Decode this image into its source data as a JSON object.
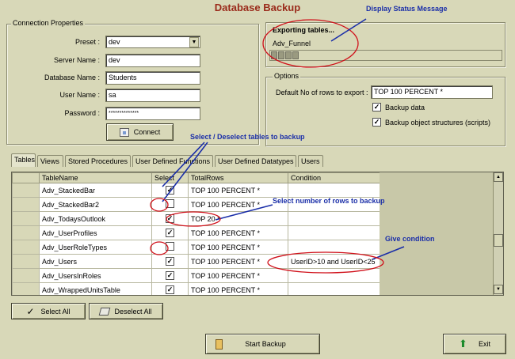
{
  "window": {
    "title": "Database Backup"
  },
  "connection": {
    "group_label": "Connection Properties",
    "preset_label": "Preset :",
    "preset_value": "dev",
    "server_label": "Server Name :",
    "server_value": "dev",
    "database_label": "Database Name :",
    "database_value": "Students",
    "user_label": "User Name :",
    "user_value": "sa",
    "password_label": "Password :",
    "password_value": "**************",
    "connect_label": "Connect"
  },
  "status": {
    "heading": "Exporting tables...",
    "current_table": "Adv_Funnel",
    "progress_fraction": 0.11
  },
  "options": {
    "group_label": "Options",
    "default_rows_label": "Default No of rows to export :",
    "default_rows_value": "TOP 100 PERCENT *",
    "backup_data_label": "Backup data",
    "backup_data_checked": true,
    "backup_structures_label": "Backup object structures (scripts)",
    "backup_structures_checked": true
  },
  "tabs": [
    {
      "label": "Tables",
      "active": true
    },
    {
      "label": "Views"
    },
    {
      "label": "Stored Procedures"
    },
    {
      "label": "User Defined Functions"
    },
    {
      "label": "User Defined Datatypes"
    },
    {
      "label": "Users"
    }
  ],
  "grid": {
    "columns": [
      "TableName",
      "Select",
      "TotalRows",
      "Condition"
    ],
    "rows": [
      {
        "name": "Adv_StackedBar",
        "checked": true,
        "rows": "TOP 100 PERCENT *",
        "condition": ""
      },
      {
        "name": "Adv_StackedBar2",
        "checked": false,
        "rows": "TOP 100 PERCENT *",
        "condition": ""
      },
      {
        "name": "Adv_TodaysOutlook",
        "checked": true,
        "rows": "TOP 20 *",
        "condition": ""
      },
      {
        "name": "Adv_UserProfiles",
        "checked": true,
        "rows": "TOP 100 PERCENT *",
        "condition": ""
      },
      {
        "name": "Adv_UserRoleTypes",
        "checked": false,
        "rows": "TOP 100 PERCENT *",
        "condition": ""
      },
      {
        "name": "Adv_Users",
        "checked": true,
        "rows": "TOP 100 PERCENT *",
        "condition": "UserID>10 and UserID<25"
      },
      {
        "name": "Adv_UsersInRoles",
        "checked": true,
        "rows": "TOP 100 PERCENT *",
        "condition": ""
      },
      {
        "name": "Adv_WrappedUnitsTable",
        "checked": true,
        "rows": "TOP 100 PERCENT *",
        "condition": ""
      }
    ]
  },
  "buttons": {
    "select_all": "Select All",
    "deselect_all": "Deselect All",
    "start_backup": "Start Backup",
    "exit": "Exit"
  },
  "annotations": {
    "status_message": "Display Status Message",
    "select_tables": "Select / Deselect tables to backup",
    "select_rows": "Select number of rows to backup",
    "give_condition": "Give condition"
  },
  "colors": {
    "title": "#9a2a1a",
    "annotation": "#1a2ea8",
    "annotation_circle": "#d0101a",
    "window_bg": "#d8d8b8"
  }
}
